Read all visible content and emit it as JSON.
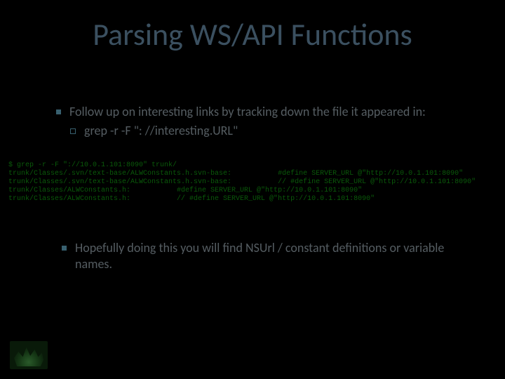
{
  "title": "Parsing WS/API Functions",
  "bullet1": "Follow up on interesting links by tracking down the file it appeared in:",
  "bullet1_sub": "grep -r -F \": //interesting.URL\"",
  "terminal": "$ grep -r -F \"://10.0.1.101:8090\" trunk/\ntrunk/Classes/.svn/text-base/ALWConstants.h.svn-base:           #define SERVER_URL @\"http://10.0.1.101:8090\"\ntrunk/Classes/.svn/text-base/ALWConstants.h.svn-base:           // #define SERVER_URL @\"http://10.0.1.101:8090\"\ntrunk/Classes/ALWConstants.h:           #define SERVER_URL @\"http://10.0.1.101:8090\"\ntrunk/Classes/ALWConstants.h:           // #define SERVER_URL @\"http://10.0.1.101:8090\"",
  "bullet2": "Hopefully doing this you will find NSUrl / constant definitions or variable names."
}
